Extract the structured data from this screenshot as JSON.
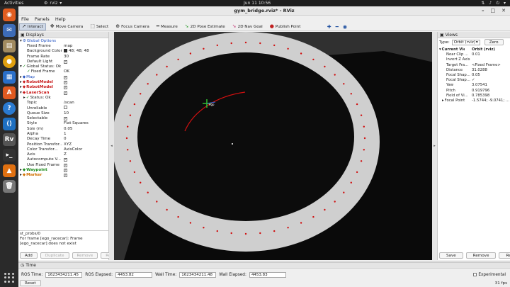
{
  "system": {
    "activities": "Activities",
    "app_name": "rviz",
    "clock": "Jun 11  10:56"
  },
  "window": {
    "title": "gym_bridge.rviz* - RViz"
  },
  "menu": [
    "File",
    "Panels",
    "Help"
  ],
  "toolbar": [
    {
      "label": "Interact",
      "icon": "cursor-icon",
      "active": true
    },
    {
      "label": "Move Camera",
      "icon": "move-icon"
    },
    {
      "label": "Select",
      "icon": "select-icon"
    },
    {
      "label": "Focus Camera",
      "icon": "focus-icon"
    },
    {
      "label": "Measure",
      "icon": "ruler-icon"
    },
    {
      "label": "2D Pose Estimate",
      "icon": "arrow-green-icon"
    },
    {
      "label": "2D Nav Goal",
      "icon": "arrow-pink-icon"
    },
    {
      "label": "Publish Point",
      "icon": "pin-icon"
    }
  ],
  "displays": {
    "title": "Displays",
    "rows": [
      {
        "indent": 0,
        "arrow": "▾",
        "label": "Global Options",
        "cls": "blue",
        "icon": "gear-icon"
      },
      {
        "indent": 2,
        "label": "Fixed Frame",
        "value": "map"
      },
      {
        "indent": 2,
        "label": "Background Color",
        "value": "48; 48; 48",
        "swatch": "#303030"
      },
      {
        "indent": 2,
        "label": "Frame Rate",
        "value": "30"
      },
      {
        "indent": 2,
        "label": "Default Light",
        "check": true
      },
      {
        "indent": 0,
        "arrow": "▾",
        "label": "Global Status: Ok",
        "icon": "check-icon"
      },
      {
        "indent": 2,
        "label": "Fixed Frame",
        "value": "OK",
        "icon": "check-icon"
      },
      {
        "indent": 0,
        "arrow": "▸",
        "label": "Map",
        "cls": "blue",
        "check": true
      },
      {
        "indent": 0,
        "arrow": "▸",
        "label": "RobotModel",
        "cls": "red",
        "check": true
      },
      {
        "indent": 0,
        "arrow": "▸",
        "label": "RobotModel",
        "cls": "red",
        "check": true
      },
      {
        "indent": 0,
        "arrow": "▾",
        "label": "LaserScan",
        "cls": "red",
        "check": true
      },
      {
        "indent": 1,
        "arrow": "▸",
        "label": "Status: Ok",
        "icon": "check-icon"
      },
      {
        "indent": 2,
        "label": "Topic",
        "value": "/scan"
      },
      {
        "indent": 2,
        "label": "Unreliable",
        "check": false
      },
      {
        "indent": 2,
        "label": "Queue Size",
        "value": "10"
      },
      {
        "indent": 2,
        "label": "Selectable",
        "check": true
      },
      {
        "indent": 2,
        "label": "Style",
        "value": "Flat Squares"
      },
      {
        "indent": 2,
        "label": "Size (m)",
        "value": "0.05"
      },
      {
        "indent": 2,
        "label": "Alpha",
        "value": "1"
      },
      {
        "indent": 2,
        "label": "Decay Time",
        "value": "0"
      },
      {
        "indent": 2,
        "label": "Position Transfor...",
        "value": "XYZ"
      },
      {
        "indent": 2,
        "label": "Color Transfor...",
        "value": "AxisColor"
      },
      {
        "indent": 2,
        "label": "Axis",
        "value": "Z"
      },
      {
        "indent": 2,
        "label": "Autocompute V...",
        "check": true
      },
      {
        "indent": 2,
        "label": "Use Fixed Frame",
        "check": true
      },
      {
        "indent": 0,
        "arrow": "▸",
        "label": "Waypoint",
        "cls": "green",
        "check": true
      },
      {
        "indent": 0,
        "arrow": "▸",
        "label": "Marker",
        "cls": "org",
        "check": true
      }
    ],
    "status_title": "st_probs/0",
    "status_text": "For frame [ego_racecar]: Frame [ego_racecar] does not exist",
    "buttons": [
      {
        "label": "Add",
        "enabled": true
      },
      {
        "label": "Duplicate",
        "enabled": false
      },
      {
        "label": "Remove",
        "enabled": false
      },
      {
        "label": "Rename",
        "enabled": false
      }
    ]
  },
  "views": {
    "title": "Views",
    "type_label": "Type:",
    "type_value": "Orbit (rviz)",
    "zero_label": "Zero",
    "rows": [
      {
        "arrow": "▾",
        "label": "Current View",
        "value": "Orbit (rviz)",
        "bold": true
      },
      {
        "label": "Near Clip ...",
        "value": "0.01"
      },
      {
        "label": "Invert Z Axis",
        "value": ""
      },
      {
        "label": "Target Fra...",
        "value": "<Fixed Frame>"
      },
      {
        "label": "Distance",
        "value": "31.0288"
      },
      {
        "label": "Focal Shap...",
        "value": "0.05"
      },
      {
        "label": "Focal Shap...",
        "value": "✓"
      },
      {
        "label": "Yaw",
        "value": "3.07541"
      },
      {
        "label": "Pitch",
        "value": "0.919796"
      },
      {
        "label": "Field of Vi...",
        "value": "0.785398"
      },
      {
        "label": "Focal Point",
        "value": "-1.5744; -9.0741; ...",
        "arrow": "▸"
      }
    ],
    "buttons": [
      "Save",
      "Remove",
      "Rename"
    ]
  },
  "time": {
    "title": "Time",
    "ros_time_label": "ROS Time:",
    "ros_time": "1623434211.45",
    "ros_elapsed_label": "ROS Elapsed:",
    "ros_elapsed": "4453.82",
    "wall_time_label": "Wall Time:",
    "wall_time": "1623434211.48",
    "wall_elapsed_label": "Wall Elapsed:",
    "wall_elapsed": "4453.83",
    "experimental_label": "Experimental",
    "reset_label": "Reset",
    "fps": "31 fps"
  },
  "colors": {
    "viewport_bg": "#303030",
    "track": "#cfcfcf",
    "laser": "#d01010",
    "accent": "#cfd8e6"
  }
}
